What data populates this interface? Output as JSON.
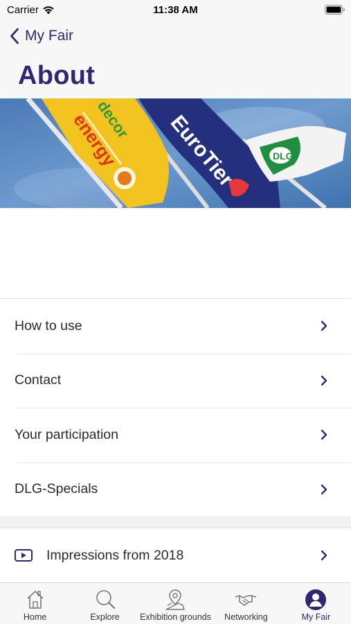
{
  "status_bar": {
    "carrier": "Carrier",
    "time": "11:38 AM"
  },
  "nav": {
    "back_label": "My Fair",
    "title": "About"
  },
  "hero": {
    "flags": [
      "energy decor",
      "EuroTier",
      "DLG"
    ]
  },
  "menu": {
    "items": [
      {
        "label": "How to use"
      },
      {
        "label": "Contact"
      },
      {
        "label": "Your participation"
      },
      {
        "label": "DLG-Specials"
      }
    ],
    "media_item": {
      "label": "Impressions from 2018",
      "icon": "video-icon"
    }
  },
  "tab_bar": {
    "tabs": [
      {
        "label": "Home",
        "icon": "home-icon"
      },
      {
        "label": "Explore",
        "icon": "search-icon"
      },
      {
        "label": "Exhibition grounds",
        "icon": "map-pin-icon"
      },
      {
        "label": "Networking",
        "icon": "handshake-icon"
      },
      {
        "label": "My Fair",
        "icon": "user-icon",
        "active": true
      }
    ]
  },
  "colors": {
    "accent": "#2e2874",
    "background": "#f2f2f4"
  }
}
